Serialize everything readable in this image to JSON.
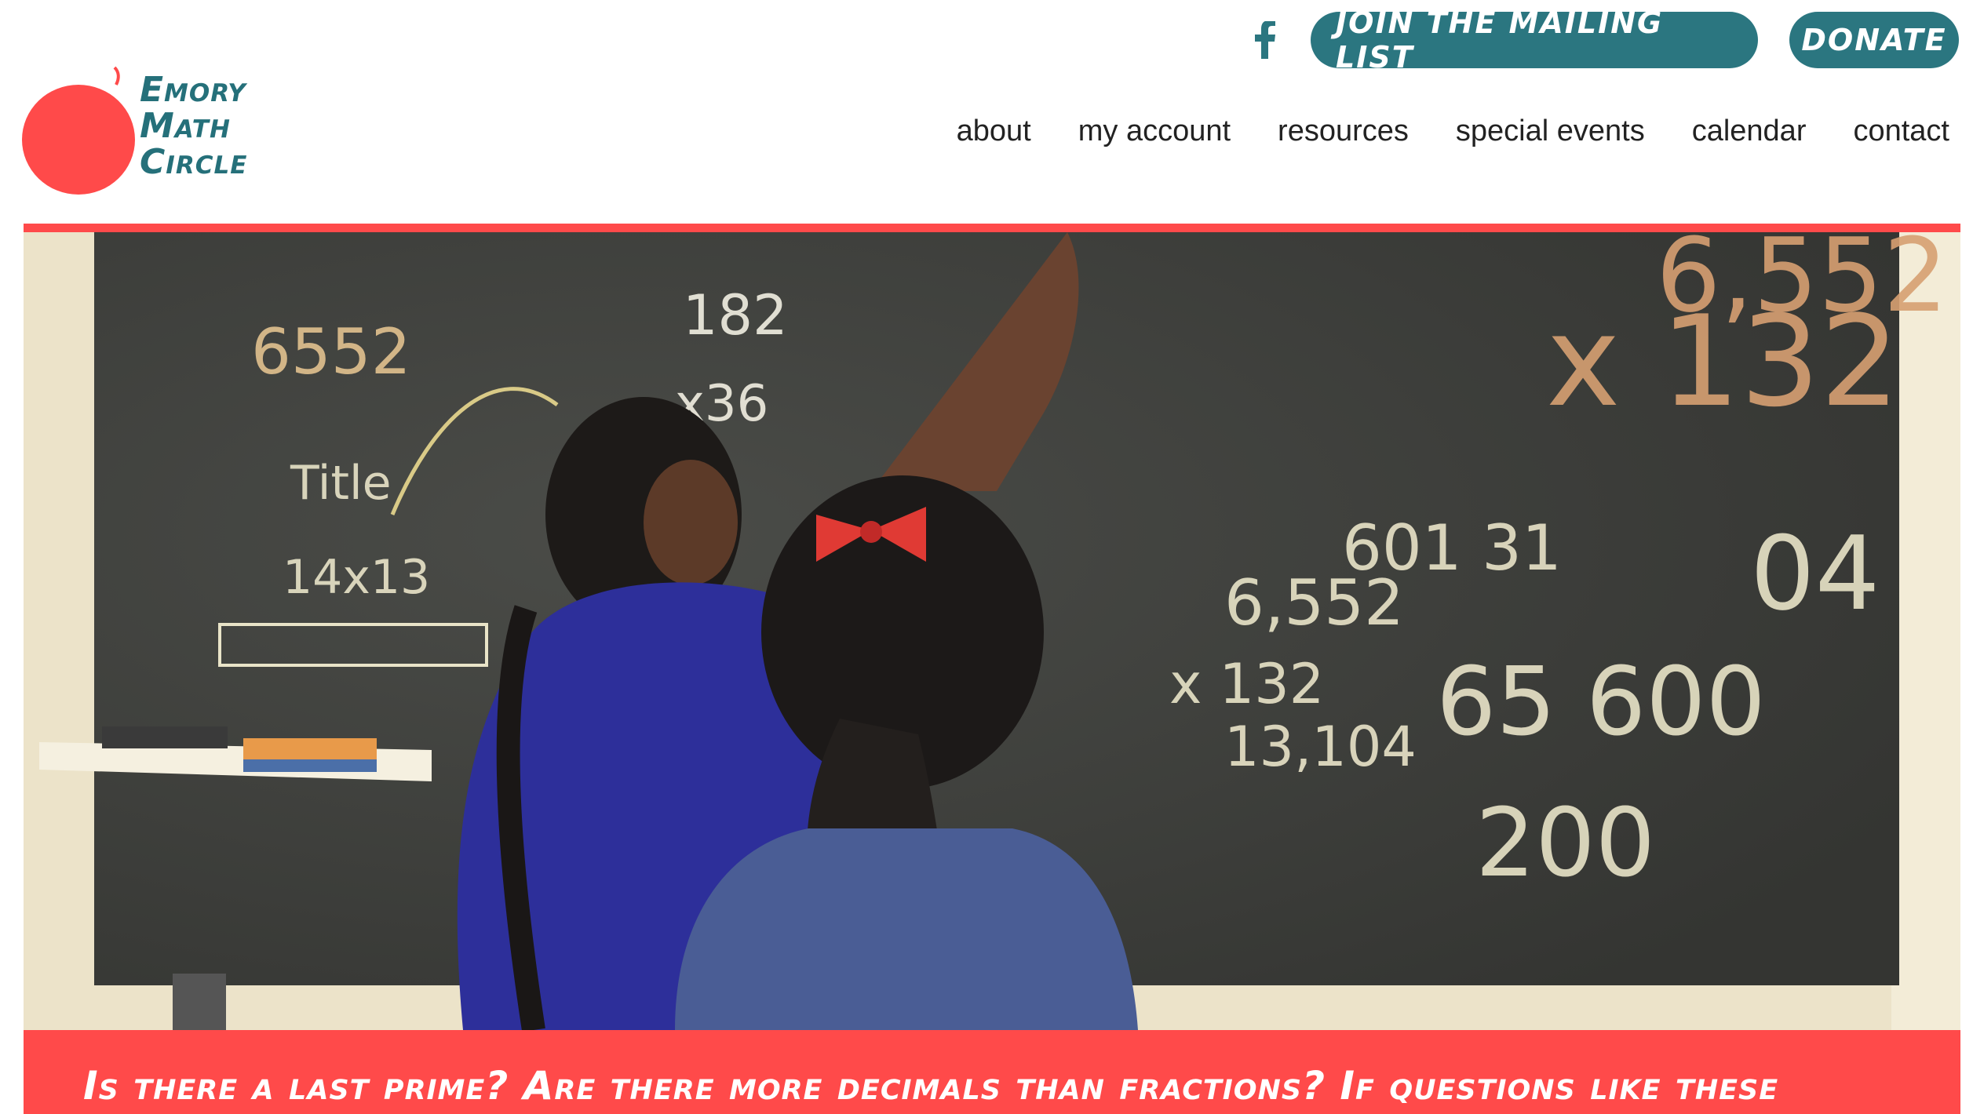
{
  "brand": {
    "name_lines": [
      "Emory",
      "Math",
      "Circle"
    ],
    "accent_red": "#ff4a4a",
    "teal": "#2b7680"
  },
  "top_actions": {
    "facebook_icon": "facebook-icon",
    "mailing_list_label": "Join the Mailing List",
    "donate_label": "Donate"
  },
  "nav": {
    "items": [
      "about",
      "my account",
      "resources",
      "special events",
      "calendar",
      "contact"
    ]
  },
  "banner": {
    "text": "Is there a last prime? Are there more decimals than fractions? If questions like these"
  }
}
